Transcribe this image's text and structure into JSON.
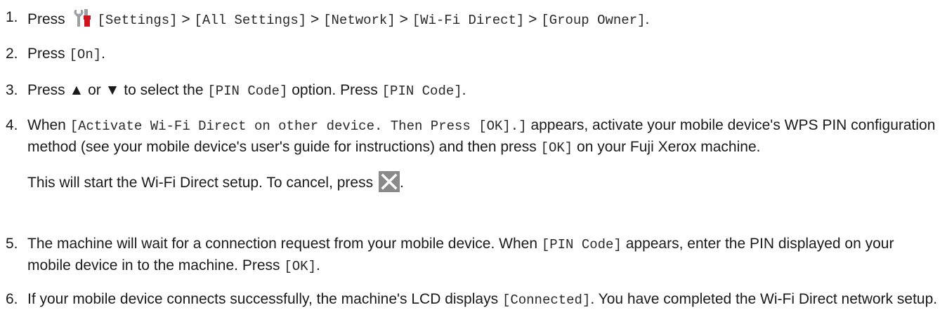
{
  "steps": [
    {
      "number": "1.",
      "press": "Press",
      "path": [
        {
          "label": "[Settings]"
        },
        {
          "label": "[All Settings]"
        },
        {
          "label": "[Network]"
        },
        {
          "label": "[Wi-Fi Direct]"
        },
        {
          "label": "[Group Owner]"
        }
      ],
      "sep": ">",
      "end": "."
    },
    {
      "number": "2.",
      "press": "Press",
      "value": "[On]",
      "end": "."
    },
    {
      "number": "3.",
      "t1": "Press ▲ or ▼ to select the",
      "opt": "[PIN Code]",
      "t2": "option. Press",
      "opt2": "[PIN Code]",
      "end": "."
    },
    {
      "number": "4.",
      "t1": "When",
      "msg": "[Activate Wi-Fi Direct on other device. Then Press [OK].]",
      "t2": "appears, activate your mobile device's WPS PIN configuration method (see your mobile device's user's guide for instructions) and then press",
      "ok": "[OK]",
      "t3": "on your Fuji Xerox machine.",
      "note": "This will start the Wi-Fi Direct setup. To cancel, press",
      "note_end": "."
    },
    {
      "number": "5.",
      "t1": "The machine will wait for a connection request from your mobile device. When",
      "code": "[PIN Code]",
      "t2": "appears, enter the PIN displayed on your mobile device in to the machine. Press",
      "ok": "[OK]",
      "end": "."
    },
    {
      "number": "6.",
      "t1": "If your mobile device connects successfully, the machine's LCD displays",
      "status": "[Connected]",
      "t2": ". You have completed the Wi-Fi Direct network setup."
    }
  ]
}
